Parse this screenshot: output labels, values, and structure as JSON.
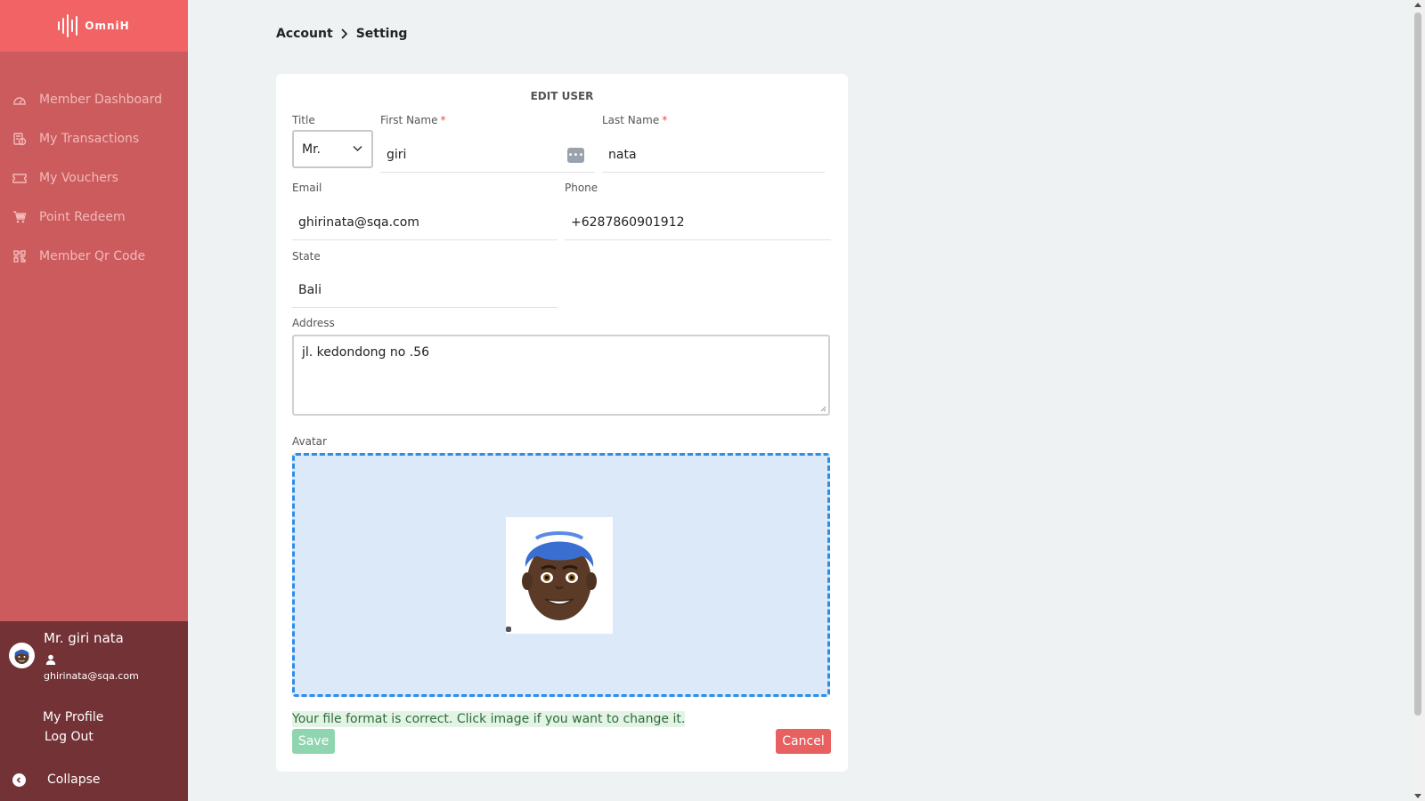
{
  "app": {
    "name": "OmniH"
  },
  "sidebar": {
    "items": [
      {
        "label": "Member Dashboard",
        "icon": "dashboard-icon"
      },
      {
        "label": "My Transactions",
        "icon": "transactions-icon"
      },
      {
        "label": "My Vouchers",
        "icon": "voucher-icon"
      },
      {
        "label": "Point Redeem",
        "icon": "cart-icon"
      },
      {
        "label": "Member Qr Code",
        "icon": "qr-code-icon"
      }
    ]
  },
  "user": {
    "name": "Mr. giri nata",
    "email": "ghirinata@sqa.com",
    "profile_label": "My Profile",
    "logout_label": "Log Out",
    "collapse_label": "Collapse"
  },
  "breadcrumb": {
    "parent": "Account",
    "current": "Setting"
  },
  "form": {
    "heading": "EDIT USER",
    "title": {
      "label": "Title",
      "value": "Mr."
    },
    "first_name": {
      "label": "First Name",
      "value": "giri",
      "required": "*"
    },
    "last_name": {
      "label": "Last Name",
      "value": "nata",
      "required": "*"
    },
    "email": {
      "label": "Email",
      "value": "ghirinata@sqa.com"
    },
    "phone": {
      "label": "Phone",
      "value": "+6287860901912"
    },
    "state": {
      "label": "State",
      "value": "Bali"
    },
    "address": {
      "label": "Address",
      "value": "jl. kedondong no .56"
    },
    "avatar": {
      "label": "Avatar"
    },
    "file_message": "Your file format is correct. Click image if you want to change it.",
    "save_label": "Save",
    "cancel_label": "Cancel"
  },
  "colors": {
    "sidebar": "#cb5b5d",
    "logo_bar": "#f16364",
    "user_panel": "#733236",
    "dropzone_border": "#2d8ee8",
    "save": "#8fd6b0",
    "cancel": "#e8605f"
  }
}
